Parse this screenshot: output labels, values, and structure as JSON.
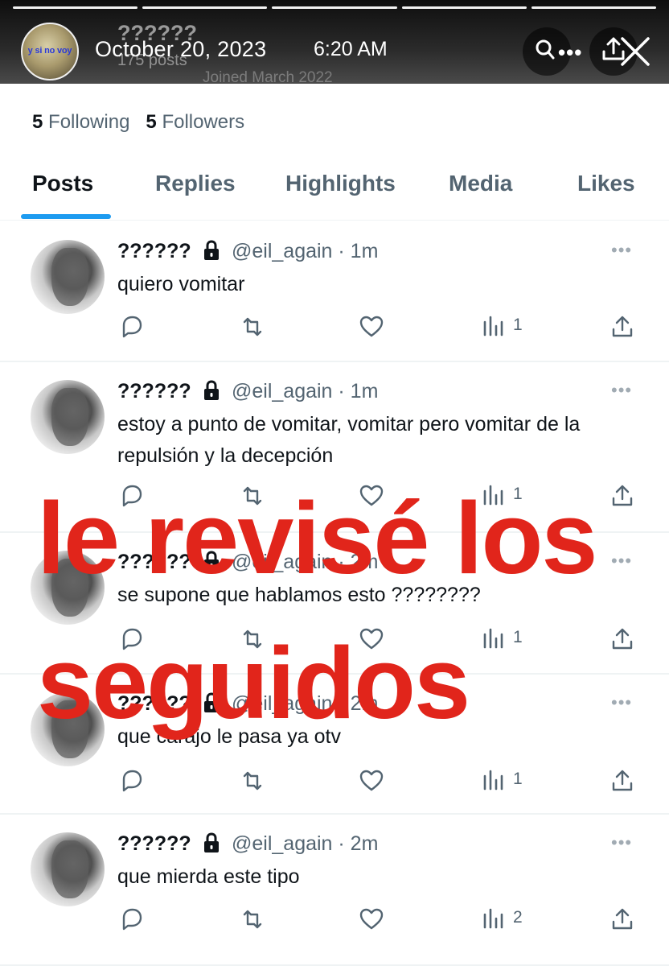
{
  "story": {
    "avatar_caption": "y si no voy",
    "ghost_name": "??????",
    "ghost_posts": "175 posts",
    "ghost_joined": "Joined March 2022",
    "date": "October 20, 2023",
    "time": "6:20 AM",
    "overlay_line1": "le revisé los",
    "overlay_line2": "seguidos"
  },
  "profile": {
    "following_count": "5",
    "following_label": "Following",
    "followers_count": "5",
    "followers_label": "Followers"
  },
  "tabs": [
    {
      "label": "Posts"
    },
    {
      "label": "Replies"
    },
    {
      "label": "Highlights"
    },
    {
      "label": "Media"
    },
    {
      "label": "Likes"
    }
  ],
  "tweets": [
    {
      "name": "??????",
      "handle": "@eil_again · 1m",
      "text": "quiero vomitar",
      "views": "1"
    },
    {
      "name": "??????",
      "handle": "@eil_again · 1m",
      "text": "estoy a punto de vomitar, vomitar pero vomitar de la repulsión y la decepción",
      "views": "1"
    },
    {
      "name": "??????",
      "handle": "@eil_again · 2m",
      "text": "se supone que hablamos esto ????????",
      "views": "1"
    },
    {
      "name": "??????",
      "handle": "@eil_again · 2m",
      "text": "que carajo le pasa ya otv",
      "views": "1"
    },
    {
      "name": "??????",
      "handle": "@eil_again · 2m",
      "text": "que mierda este tipo",
      "views": "2"
    }
  ],
  "colors": {
    "accent": "#1d9bf0",
    "overlay_red": "#e1251b",
    "muted": "#536471"
  }
}
